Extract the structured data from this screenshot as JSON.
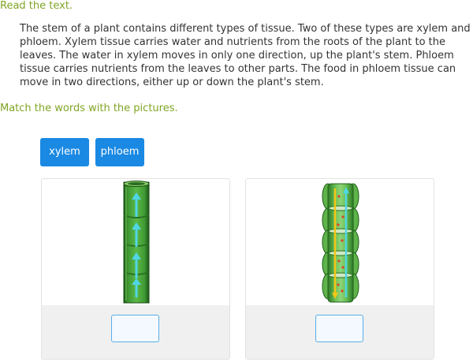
{
  "instructions": {
    "read": "Read the text.",
    "match": "Match the words with the pictures."
  },
  "passage": "The stem of a plant contains different types of tissue. Two of these types are xylem and phloem. Xylem tissue carries water and nutrients from the roots of the plant to the leaves. The water in xylem moves in only one direction, up the plant's stem. Phloem tissue carries nutrients from the leaves to other parts. The food in phloem tissue can move in two directions, either up or down the plant's stem.",
  "word_bank": [
    {
      "label": "xylem"
    },
    {
      "label": "phloem"
    }
  ],
  "cards": [
    {
      "picture": "xylem-tube-illustration",
      "answer": ""
    },
    {
      "picture": "phloem-tube-illustration",
      "answer": ""
    }
  ],
  "colors": {
    "instruction_green": "#7fa524",
    "tile_blue": "#1a89e3",
    "drop_border": "#5aaee8",
    "footer_gray": "#f0f0f0",
    "tube_green": "#3d9432",
    "arrow_cyan": "#4fd6e6",
    "arrow_yellow": "#f3c615",
    "dot_red": "#d9452b"
  }
}
